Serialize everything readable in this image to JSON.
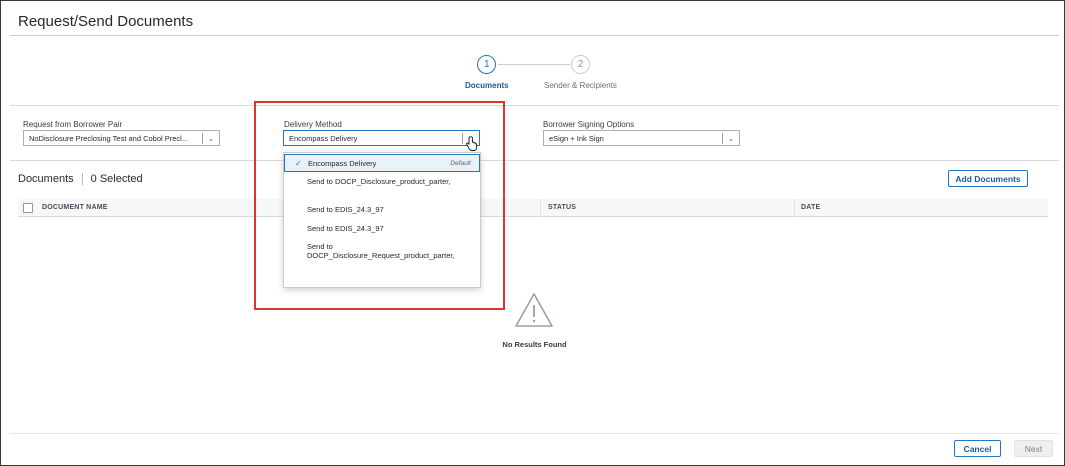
{
  "modal": {
    "title": "Request/Send Documents"
  },
  "stepper": {
    "steps": [
      {
        "number": "1",
        "label": "Documents"
      },
      {
        "number": "2",
        "label": "Sender & Recipients"
      }
    ]
  },
  "borrower_pair": {
    "label": "Request from Borrower Pair",
    "value": "NoDisclosure Preclosing Test and Cobol Precl..."
  },
  "delivery_method": {
    "label": "Delivery Method",
    "value": "Encompass Delivery",
    "options": [
      {
        "label": "Encompass Delivery",
        "tag": "Default"
      },
      {
        "label": "Send to DOCP_Disclosure_product_parter,"
      },
      {
        "label": "Send to EDIS_24.3_97"
      },
      {
        "label": "Send to EDIS_24.3_97"
      },
      {
        "label": "Send to DOCP_Disclosure_Request_product_parter,"
      }
    ]
  },
  "signing_options": {
    "label": "Borrower Signing Options",
    "value": "eSign + Ink Sign"
  },
  "documents": {
    "title": "Documents",
    "selected": "0 Selected",
    "add_button": "Add Documents",
    "columns": [
      "DOCUMENT NAME",
      "STATUS",
      "DATE"
    ],
    "empty_text": "No Results Found"
  },
  "footer": {
    "cancel": "Cancel",
    "next": "Next"
  },
  "colors": {
    "accent": "#1e79c2",
    "highlight": "#e0332e"
  },
  "icons": [
    "check-icon",
    "chevron-down-icon",
    "warning-icon",
    "hand-pointer-icon"
  ]
}
